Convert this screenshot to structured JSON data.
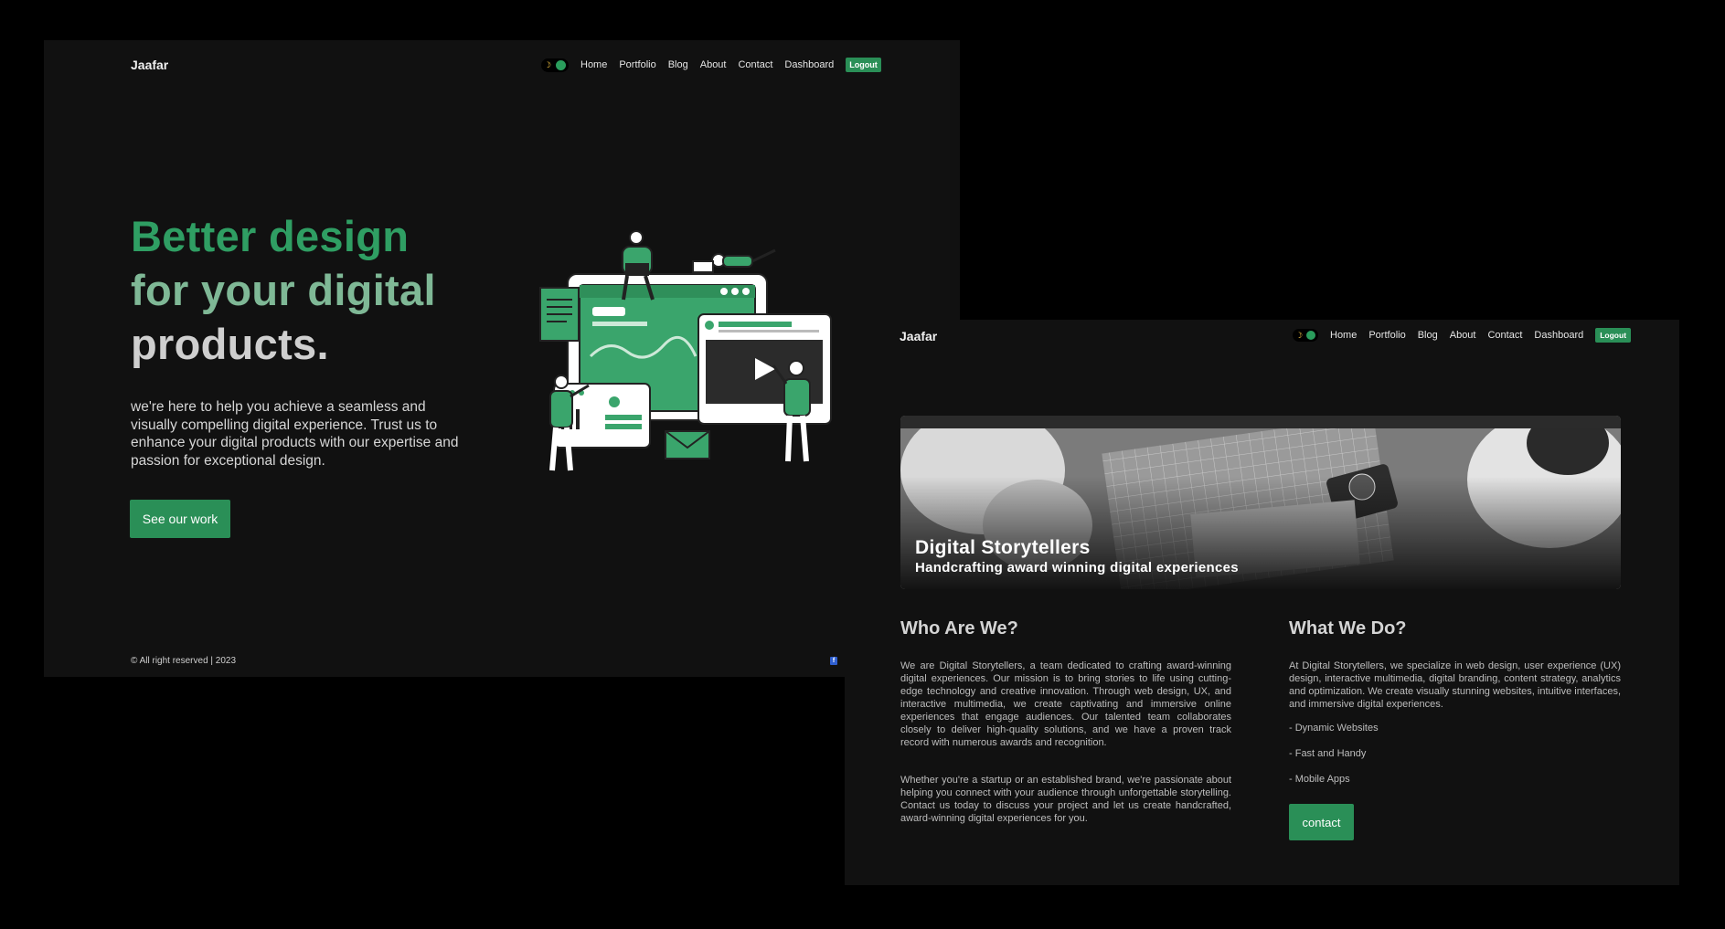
{
  "screen1": {
    "nav": {
      "brand": "Jaafar",
      "links": [
        "Home",
        "Portfolio",
        "Blog",
        "About",
        "Contact",
        "Dashboard"
      ],
      "logout": "Logout"
    },
    "hero": {
      "title_line1": "Better design",
      "title_line2": "for your digital",
      "title_line3": "products.",
      "text": "we're here to help you achieve a seamless and visually compelling digital experience. Trust us to enhance your digital products with our expertise and passion for exceptional design.",
      "cta": "See our work"
    },
    "footer": {
      "copyright": "© All right reserved | 2023",
      "social_icon": "facebook-icon"
    }
  },
  "screen2": {
    "nav": {
      "brand": "Jaafar",
      "links": [
        "Home",
        "Portfolio",
        "Blog",
        "About",
        "Contact",
        "Dashboard"
      ],
      "logout": "Logout"
    },
    "banner": {
      "title": "Digital Storytellers",
      "subtitle": "Handcrafting award winning digital experiences"
    },
    "who": {
      "heading": "Who Are We?",
      "p1": "We are Digital Storytellers, a team dedicated to crafting award-winning digital experiences. Our mission is to bring stories to life using cutting-edge technology and creative innovation. Through web design, UX, and interactive multimedia, we create captivating and immersive online experiences that engage audiences. Our talented team collaborates closely to deliver high-quality solutions, and we have a proven track record with numerous awards and recognition.",
      "p2": "Whether you're a startup or an established brand, we're passionate about helping you connect with your audience through unforgettable storytelling. Contact us today to discuss your project and let us create handcrafted, award-winning digital experiences for you."
    },
    "what": {
      "heading": "What We Do?",
      "p1": "At Digital Storytellers, we specialize in web design, user experience (UX) design, interactive multimedia, digital branding, content strategy, analytics and optimization. We create visually stunning websites, intuitive interfaces, and immersive digital experiences.",
      "services": [
        "- Dynamic Websites",
        "- Fast and Handy",
        "- Mobile Apps"
      ],
      "contact_button": "contact"
    }
  },
  "colors": {
    "accent": "#2a8f57",
    "title_green": "#2f9e63",
    "title_light_green": "#7fb896",
    "background": "#111111"
  }
}
